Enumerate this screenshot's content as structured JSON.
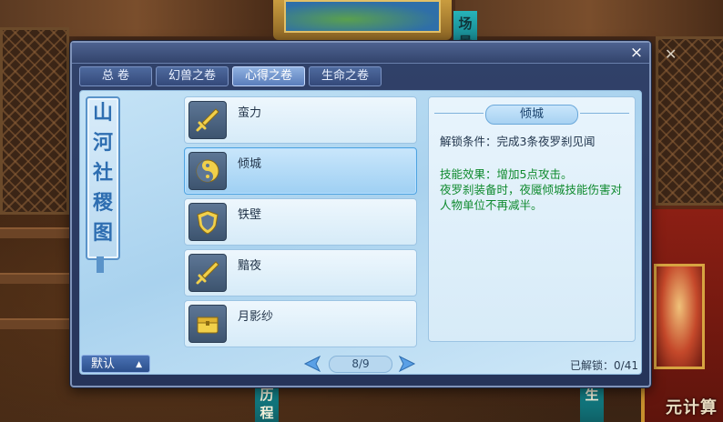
{
  "window": {
    "close_label": "×",
    "tabs": [
      {
        "label": "总 卷",
        "active": false
      },
      {
        "label": "幻兽之卷",
        "active": false
      },
      {
        "label": "心得之卷",
        "active": true
      },
      {
        "label": "生命之卷",
        "active": false
      }
    ]
  },
  "seal": {
    "chars": [
      "山",
      "河",
      "社",
      "稷",
      "图"
    ]
  },
  "list": {
    "items": [
      {
        "name": "蛮力",
        "icon": "sword-icon",
        "selected": false
      },
      {
        "name": "倾城",
        "icon": "yin-yang-icon",
        "selected": true
      },
      {
        "name": "铁壁",
        "icon": "shield-icon",
        "selected": false
      },
      {
        "name": "黯夜",
        "icon": "sword-icon",
        "selected": false
      },
      {
        "name": "月影纱",
        "icon": "chest-icon",
        "selected": false
      }
    ]
  },
  "detail": {
    "title": "倾城",
    "unlock_condition": "解锁条件：完成3条夜罗刹见闻",
    "effect_line1": "技能效果：增加5点攻击。",
    "effect_line2": "夜罗刹装备时，夜魇倾城技能伤害对人物单位不再减半。"
  },
  "footer": {
    "default_label": "默认",
    "default_arrow": "▲",
    "page": "8/9",
    "unlocked": "已解锁：0/41"
  },
  "background": {
    "banner_top": "场 景",
    "banner_bottom_left": "历 程",
    "banner_bottom_right": "生",
    "watermark": "元计算"
  },
  "colors": {
    "effect_text": "#0f8a2e",
    "accent_blue": "#4ea3e0"
  }
}
